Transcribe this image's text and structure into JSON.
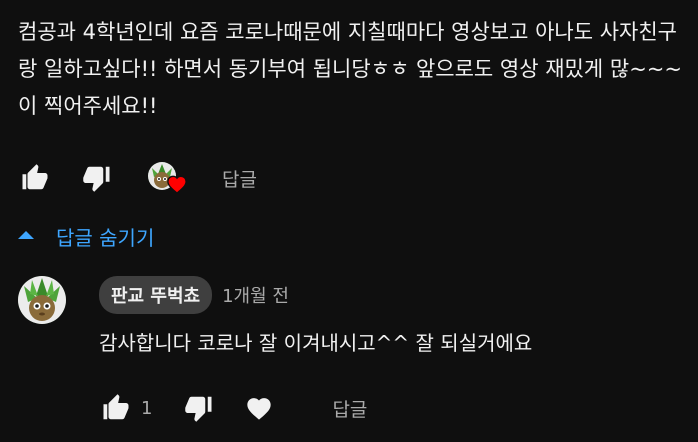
{
  "comment": {
    "text": "컴공과 4학년인데 요즘 코로나때문에 지칠때마다 영상보고 아나도 사자친구랑 일하고싶다!! 하면서 동기부여 됩니당ㅎㅎ 앞으로도 영상 재밌게 많~~~이 찍어주세요!!",
    "reply_label": "답글"
  },
  "replies_toggle": {
    "label": "답글 숨기기"
  },
  "reply": {
    "author": "판교 뚜벅쵸",
    "time": "1개월 전",
    "text": "감사합니다 코로나 잘 이겨내시고^^ 잘 되실거에요",
    "like_count": "1",
    "reply_label": "답글"
  },
  "colors": {
    "background": "#0f0f0f",
    "text": "#f1f1f1",
    "muted": "#aaaaaa",
    "accent": "#3ea6ff",
    "heart": "#ff0000",
    "pill": "#3f3f3f"
  },
  "icons": [
    "thumb-up-icon",
    "thumb-down-icon",
    "creator-heart-icon",
    "chevron-up-icon",
    "heart-icon"
  ]
}
